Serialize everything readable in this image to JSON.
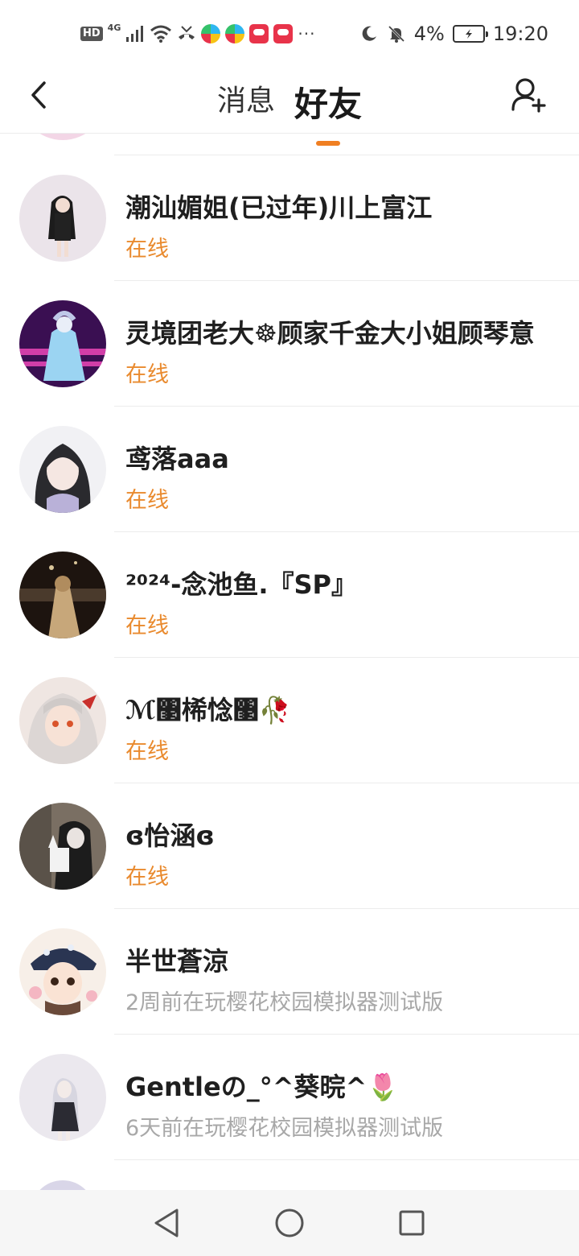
{
  "status_bar": {
    "hd": "HD",
    "network": "4G",
    "battery": "4%",
    "time": "19:20",
    "more": "···"
  },
  "header": {
    "tabs": [
      {
        "label": "消息",
        "active": false
      },
      {
        "label": "好友",
        "active": true
      }
    ],
    "accent_color": "#f07f22"
  },
  "friends": [
    {
      "name": "潮汕媚姐(已过年)川上富江",
      "status": "在线",
      "online": true
    },
    {
      "name": "灵境团老大☸顾家千金大小姐顾琴意",
      "status": "在线",
      "online": true
    },
    {
      "name": "鸢落aaa",
      "status": "在线",
      "online": true
    },
    {
      "name": "²⁰²⁴-念池鱼.『SP』",
      "status": "在线",
      "online": true
    },
    {
      "name": "ℳ঳桸惗঳🥀",
      "status": "在线",
      "online": true
    },
    {
      "name": "ɞ怡涵ɞ",
      "status": "在线",
      "online": true
    },
    {
      "name": "半世蒼涼",
      "status": "2周前在玩樱花校园模拟器测试版",
      "online": false
    },
    {
      "name": "Gentleの_°^葵晥^🌷",
      "status": "6天前在玩樱花校园模拟器测试版",
      "online": false
    }
  ],
  "colors": {
    "online": "#e98a2e",
    "offline": "#a8a8a8"
  }
}
